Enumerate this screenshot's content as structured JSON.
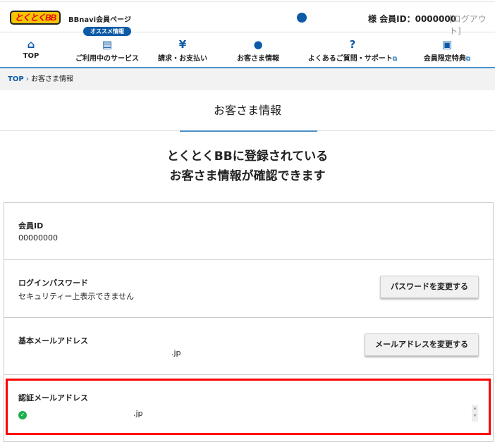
{
  "header": {
    "logo_text": "とくとくBB",
    "site_name": "BBnavi会員ページ",
    "member_label": "様 会員ID：0000000",
    "logout": "[ログアウト]"
  },
  "nav": {
    "badge": "オススメ情報",
    "items": [
      {
        "label": "TOP",
        "icon": "home-icon"
      },
      {
        "label": "ご利用中のサービス",
        "icon": "document-search-icon"
      },
      {
        "label": "請求・お支払い",
        "icon": "yen-icon"
      },
      {
        "label": "お客さま情報",
        "icon": "user-icon"
      },
      {
        "label": "よくあるご質問・サポート",
        "icon": "question-icon",
        "external": true
      },
      {
        "label": "会員限定特典",
        "icon": "gift-icon",
        "external": true
      }
    ]
  },
  "breadcrumb": {
    "home": "TOP",
    "current": "お客さま情報"
  },
  "page_title": "お客さま情報",
  "lead": {
    "line1": "とくとくBBに登録されている",
    "line2": "お客さま情報が確認できます"
  },
  "rows": [
    {
      "label": "会員ID",
      "value": "00000000"
    },
    {
      "label": "ログインパスワード",
      "value": "セキュリティー上表示できません",
      "button": "パスワードを変更する"
    },
    {
      "label": "基本メールアドレス",
      "value": ".jp",
      "button": "メールアドレスを変更する"
    },
    {
      "label": "認証メールアドレス",
      "value": ".jp"
    }
  ],
  "colors": {
    "brand": "#0d5aa7",
    "highlight": "#ff0000",
    "verified": "#1ab04b"
  }
}
